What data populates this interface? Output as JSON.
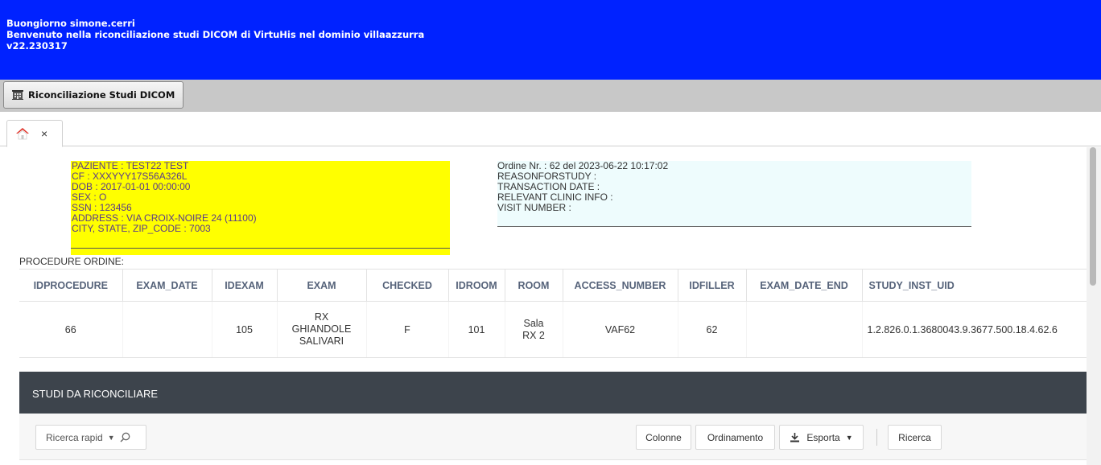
{
  "header": {
    "greeting": "Buongiorno simone.cerri",
    "welcome": "Benvenuto nella riconciliazione studi DICOM di VirtuHis nel dominio villaazzurra",
    "version": "v22.230317"
  },
  "toolbar": {
    "module_button_label": "Riconciliazione Studi DICOM"
  },
  "tabs": {
    "home_close": "×"
  },
  "patient": {
    "lines": [
      "PAZIENTE : TEST22 TEST",
      "CF : XXXYYY17S56A326L",
      "DOB : 2017-01-01 00:00:00",
      "SEX : O",
      "SSN : 123456",
      "ADDRESS : VIA CROIX-NOIRE 24 (11100)",
      "CITY, STATE, ZIP_CODE : 7003"
    ]
  },
  "order": {
    "lines": [
      "Ordine Nr. : 62 del 2023-06-22 10:17:02",
      "REASONFORSTUDY :",
      "TRANSACTION DATE :",
      "RELEVANT CLINIC INFO :",
      "VISIT NUMBER :"
    ]
  },
  "procedures": {
    "label": "PROCEDURE ORDINE:",
    "columns": [
      "IDPROCEDURE",
      "EXAM_DATE",
      "IDEXAM",
      "EXAM",
      "CHECKED",
      "IDROOM",
      "ROOM",
      "ACCESS_NUMBER",
      "IDFILLER",
      "EXAM_DATE_END",
      "STUDY_INST_UID"
    ],
    "rows": [
      [
        "66",
        "",
        "105",
        "RX GHIANDOLE SALIVARI",
        "F",
        "101",
        "Sala RX 2",
        "VAF62",
        "62",
        "",
        "1.2.826.0.1.3680043.9.3677.500.18.4.62.6"
      ]
    ]
  },
  "studi": {
    "title": "STUDI DA RICONCILIARE",
    "search_label": "Ricerca rapid",
    "buttons": {
      "colonne": "Colonne",
      "ordinamento": "Ordinamento",
      "esporta": "Esporta",
      "ricerca": "Ricerca"
    }
  },
  "colors": {
    "header_bg": "#0022ff",
    "patient_bg": "#ffff00",
    "order_bg": "#eefcfd",
    "studi_header_bg": "#3d444c",
    "home_icon": "#e0352b"
  },
  "icons": [
    "building-icon",
    "home-icon",
    "close-icon",
    "chevron-down-icon",
    "search-icon",
    "download-icon"
  ]
}
